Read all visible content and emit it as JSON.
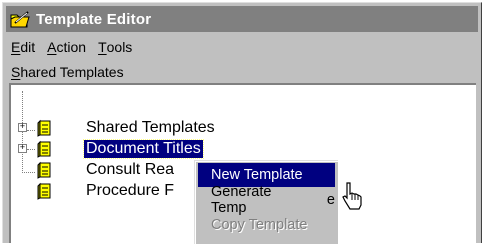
{
  "window": {
    "title": "Template Editor",
    "icon": "folder-pencil-icon"
  },
  "menubar": {
    "items": [
      {
        "mnemonic": "E",
        "rest": "dit"
      },
      {
        "mnemonic": "A",
        "rest": "ction"
      },
      {
        "mnemonic": "T",
        "rest": "ools"
      }
    ]
  },
  "pane": {
    "mnemonic": "S",
    "rest": "hared Templates"
  },
  "tree": {
    "nodes": [
      {
        "label": "Shared Templates",
        "expandable": true,
        "expander": "+"
      },
      {
        "label": "Document Titles",
        "expandable": true,
        "expander": "+",
        "selected": true
      },
      {
        "label": "Consult Rea",
        "expandable": false
      },
      {
        "label": "Procedure F",
        "expandable": false
      }
    ]
  },
  "context_menu": {
    "items": [
      {
        "label": "New Template",
        "state": "highlighted"
      },
      {
        "label": "Generate Temp",
        "state": "normal",
        "visible_suffix": "e"
      },
      {
        "label": "Copy Template",
        "state": "disabled"
      }
    ]
  },
  "colors": {
    "titlebar_inactive": "#808080",
    "selection": "#000080",
    "face": "#c0c0c0"
  }
}
